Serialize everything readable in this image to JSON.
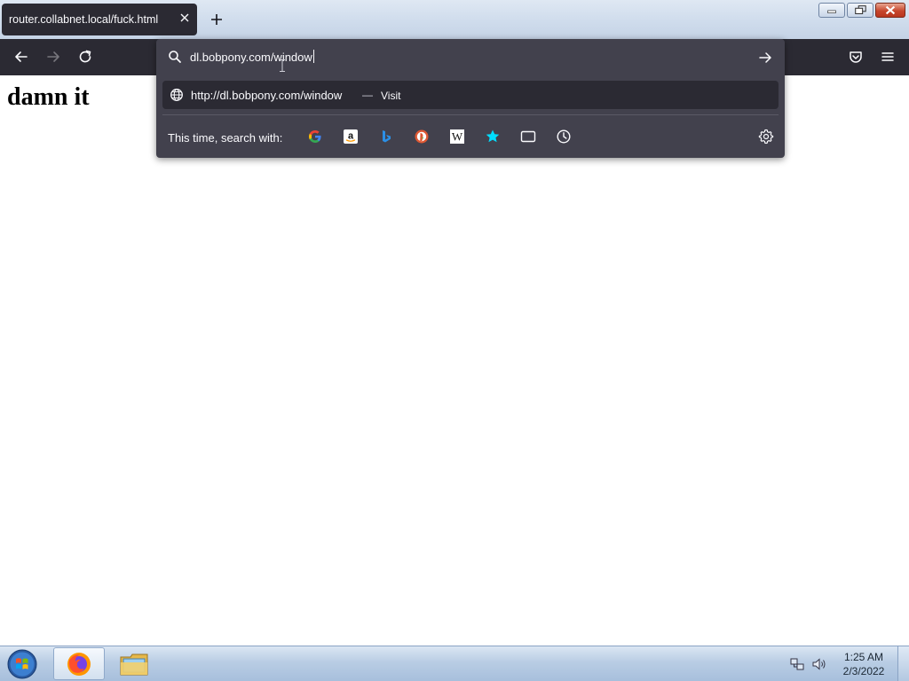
{
  "browser": {
    "tab": {
      "title": "router.collabnet.local/fuck.html"
    },
    "urlbar": {
      "typed_text": "dl.bobpony.com/window",
      "suggestion": {
        "url": "http://dl.bobpony.com/window",
        "separator": "—",
        "action": "Visit"
      },
      "one_off": {
        "label": "This time, search with:",
        "engines": [
          "google-icon",
          "amazon-icon",
          "bing-icon",
          "duckduckgo-icon",
          "wikipedia-icon",
          "bookmarks-icon",
          "tabs-icon",
          "history-icon"
        ]
      }
    },
    "colors": {
      "toolbar": "#2b2a33",
      "popup": "#42414d",
      "text": "#fbfbfe",
      "bookmark_star": "#00ddff"
    }
  },
  "page": {
    "heading": "damn it"
  },
  "taskbar": {
    "clock_time": "1:25 AM",
    "clock_date": "2/3/2022"
  }
}
